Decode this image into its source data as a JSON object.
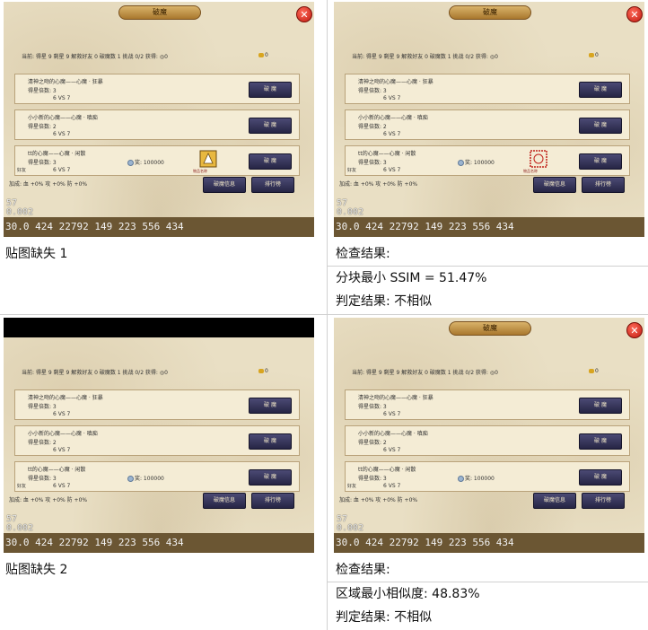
{
  "panels": [
    {
      "dialog_title": "破魔",
      "stats": "当前: 得星 9   剩星 9   解救好友 0   破魔数 1   挑战 0/2       获得: ◎0",
      "gold": "0",
      "rows": [
        {
          "name": "清神之吻的心魔——心魔 · 狂暴",
          "mult": "得星倍数: 3",
          "vs": "6 VS 7",
          "btn": "破 魔"
        },
        {
          "name": "小小新的心魔——心魔 · 嗔痴",
          "mult": "得星倍数: 2",
          "vs": "6 VS 7",
          "btn": "破 魔"
        },
        {
          "name": "tt的心魔——心魔 · 闲散",
          "mult": "得星倍数: 3",
          "vs": "6 VS 7",
          "friend": "好友",
          "reward": "奖: 100000",
          "prize_caption": "物品名称",
          "btn": "破 魔"
        }
      ],
      "bonus": "加成: 血 +0%   攻 +0%   防 +0%",
      "info_btn": "破魔信息",
      "rank_btn": "排行榜",
      "fps_top": "57",
      "fps_mid": "0.002",
      "statusbar": "30.0  424  22792  149  223  556  434"
    },
    {
      "dialog_title": "破魔",
      "stats": "当前: 得星 9   剩星 9   解救好友 0   破魔数 1   挑战 0/2       获得: ◎0",
      "gold": "0",
      "rows": [
        {
          "name": "清神之吻的心魔——心魔 · 狂暴",
          "mult": "得星倍数: 3",
          "vs": "6 VS 7",
          "btn": "破 魔"
        },
        {
          "name": "小小新的心魔——心魔 · 嗔痴",
          "mult": "得星倍数: 2",
          "vs": "6 VS 7",
          "btn": "破 魔"
        },
        {
          "name": "tt的心魔——心魔 · 闲散",
          "mult": "得星倍数: 3",
          "vs": "6 VS 7",
          "friend": "好友",
          "reward": "奖: 100000",
          "prize_caption": "物品名称",
          "btn": "破 魔"
        }
      ],
      "bonus": "加成: 血 +0%   攻 +0%   防 +0%",
      "info_btn": "破魔信息",
      "rank_btn": "排行榜",
      "fps_top": "57",
      "fps_mid": "0.002",
      "statusbar": "30.0  424  22792  149  223  556  434"
    },
    {
      "dialog_title": "",
      "stats": "当前: 得星 9   剩星 9   解救好友 0   破魔数 1   挑战 0/2       获得: ◎0",
      "gold": "0",
      "rows": [
        {
          "name": "清神之吻的心魔——心魔 · 狂暴",
          "mult": "得星倍数: 3",
          "vs": "6 VS 7",
          "btn": "破 魔"
        },
        {
          "name": "小小新的心魔——心魔 · 嗔痴",
          "mult": "得星倍数: 2",
          "vs": "6 VS 7",
          "btn": "破 魔"
        },
        {
          "name": "tt的心魔——心魔 · 闲散",
          "mult": "得星倍数: 3",
          "vs": "6 VS 7",
          "friend": "好友",
          "reward": "奖: 100000",
          "btn": "破 魔"
        }
      ],
      "bonus": "加成: 血 +0%   攻 +0%   防 +0%",
      "info_btn": "破魔信息",
      "rank_btn": "排行榜",
      "fps_top": "57",
      "fps_mid": "0.002",
      "statusbar": "30.0  424  22792  149  223  556  434"
    },
    {
      "dialog_title": "破魔",
      "stats": "当前: 得星 9   剩星 9   解救好友 0   破魔数 1   挑战 0/2       获得: ◎0",
      "gold": "0",
      "rows": [
        {
          "name": "清神之吻的心魔——心魔 · 狂暴",
          "mult": "得星倍数: 3",
          "vs": "6 VS 7",
          "btn": "破 魔"
        },
        {
          "name": "小小新的心魔——心魔 · 嗔痴",
          "mult": "得星倍数: 2",
          "vs": "6 VS 7",
          "btn": "破 魔"
        },
        {
          "name": "tt的心魔——心魔 · 闲散",
          "mult": "得星倍数: 3",
          "vs": "6 VS 7",
          "friend": "好友",
          "reward": "奖: 100000",
          "btn": "破 魔"
        }
      ],
      "bonus": "加成: 血 +0%   攻 +0%   防 +0%",
      "info_btn": "破魔信息",
      "rank_btn": "排行榜",
      "fps_top": "57",
      "fps_mid": "0.002",
      "statusbar": "30.0  424  22792  149  223  556  434"
    }
  ],
  "captions": {
    "case1_label": "贴图缺失 1",
    "case1_check": "检查结果:",
    "case1_metric": "分块最小  SSIM = 51.47%",
    "case1_verdict": "判定结果:    不相似",
    "case2_label": "贴图缺失 2",
    "case2_check": "检查结果:",
    "case2_metric": "区域最小相似度: 48.83%",
    "case2_verdict": "判定结果:    不相似"
  },
  "colors": {
    "panel_bg": "#e9dfc4",
    "button": "#34335a",
    "statusbar": "#6b5633",
    "close": "#d02418"
  },
  "icons": [
    "close-icon",
    "gold-coin-icon",
    "gem-icon",
    "prize-item-icon"
  ]
}
